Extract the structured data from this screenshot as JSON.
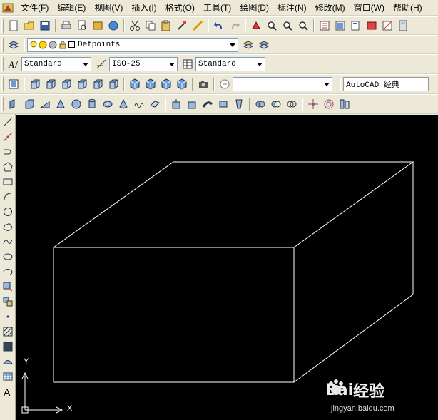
{
  "menubar": {
    "items": [
      {
        "label": "文件(F)"
      },
      {
        "label": "编辑(E)"
      },
      {
        "label": "视图(V)"
      },
      {
        "label": "插入(I)"
      },
      {
        "label": "格式(O)"
      },
      {
        "label": "工具(T)"
      },
      {
        "label": "绘图(D)"
      },
      {
        "label": "标注(N)"
      },
      {
        "label": "修改(M)"
      },
      {
        "label": "窗口(W)"
      },
      {
        "label": "帮助(H)"
      }
    ]
  },
  "layers": {
    "current_layer": "Defpoints"
  },
  "styles": {
    "text_style": "Standard",
    "dim_style": "ISO-25",
    "table_style": "Standard"
  },
  "workspace": {
    "current": "AutoCAD 经典"
  },
  "canvas": {
    "background": "#000000",
    "line_color": "#ffffff",
    "y_label": "Y",
    "x_label": "X"
  },
  "watermark": {
    "brand_a": "Bai",
    "brand_b": "经验",
    "url": "jingyan.baidu.com"
  },
  "colors": {
    "toolbar_bg": "#ece9d8",
    "icon_blue": "#3a6fb5"
  }
}
